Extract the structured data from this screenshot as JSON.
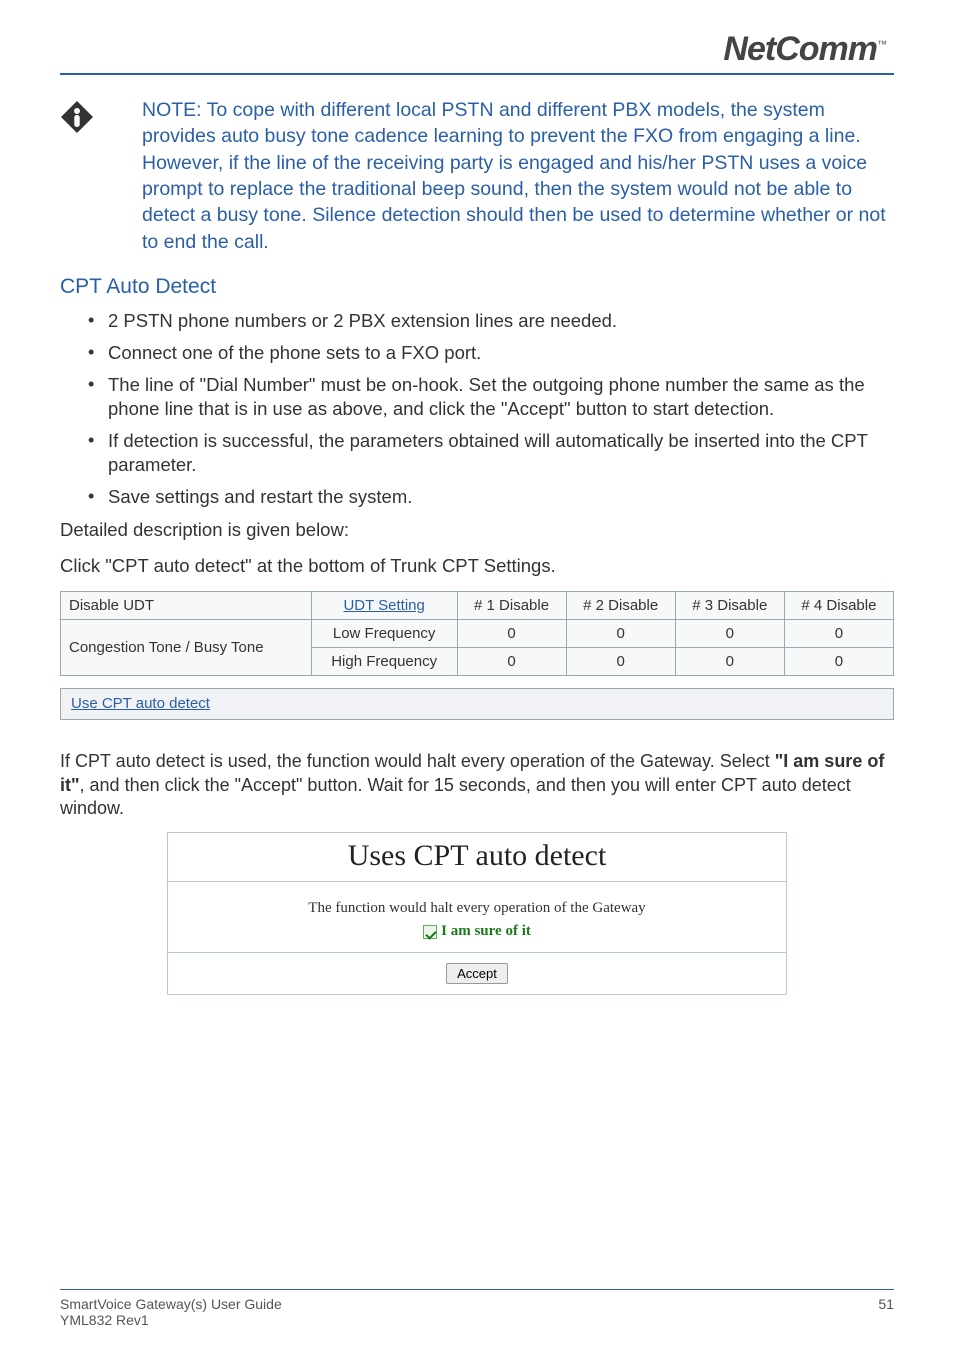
{
  "brand": {
    "name": "NetComm",
    "tm": "™"
  },
  "note": {
    "label": "NOTE:",
    "text": "To cope with different local PSTN and different PBX models, the system provides auto busy tone cadence learning to prevent the FXO from engaging a line. However, if the line of the receiving party is engaged and his/her PSTN uses a voice prompt to replace the traditional beep sound, then the system would not be able to detect a busy tone. Silence detection should then be used to determine whether or not to end the call."
  },
  "section": {
    "heading": "CPT Auto Detect",
    "bullets": [
      "2 PSTN phone numbers or 2 PBX extension lines are needed.",
      "Connect one of the phone sets to a FXO port.",
      "The line of \"Dial Number\" must be on-hook. Set the outgoing phone number the same as the phone line that is in use as above, and click the \"Accept\" button to start detection.",
      "If detection is successful, the parameters obtained will automatically be inserted into the CPT parameter.",
      "Save settings and restart the system."
    ],
    "detail": "Detailed description is given below:",
    "click_instr": "Click \"CPT auto detect\" at the bottom of Trunk CPT Settings."
  },
  "table": {
    "row1_left": "Disable UDT",
    "udt_link": "UDT Setting",
    "cols": [
      "# 1 Disable",
      "# 2 Disable",
      "# 3 Disable",
      "# 4 Disable"
    ],
    "row2_left": "Congestion Tone / Busy Tone",
    "low_label": "Low Frequency",
    "high_label": "High Frequency",
    "low_vals": [
      "0",
      "0",
      "0",
      "0"
    ],
    "high_vals": [
      "0",
      "0",
      "0",
      "0"
    ]
  },
  "linkbar": {
    "text": "Use CPT auto detect"
  },
  "para2": {
    "pre": "If CPT auto detect is used, the function would halt every operation of the Gateway. Select ",
    "bold": "\"I am sure of it\"",
    "post": ", and then click the \"Accept\" button.  Wait for 15 seconds, and then you will enter CPT auto detect window."
  },
  "panel": {
    "title": "Uses CPT auto detect",
    "body": "The function would halt every operation of the Gateway",
    "check_label": "I am sure of it",
    "accept": "Accept"
  },
  "footer": {
    "left1": "SmartVoice Gateway(s) User Guide",
    "left2": "YML832 Rev1",
    "page": "51"
  }
}
